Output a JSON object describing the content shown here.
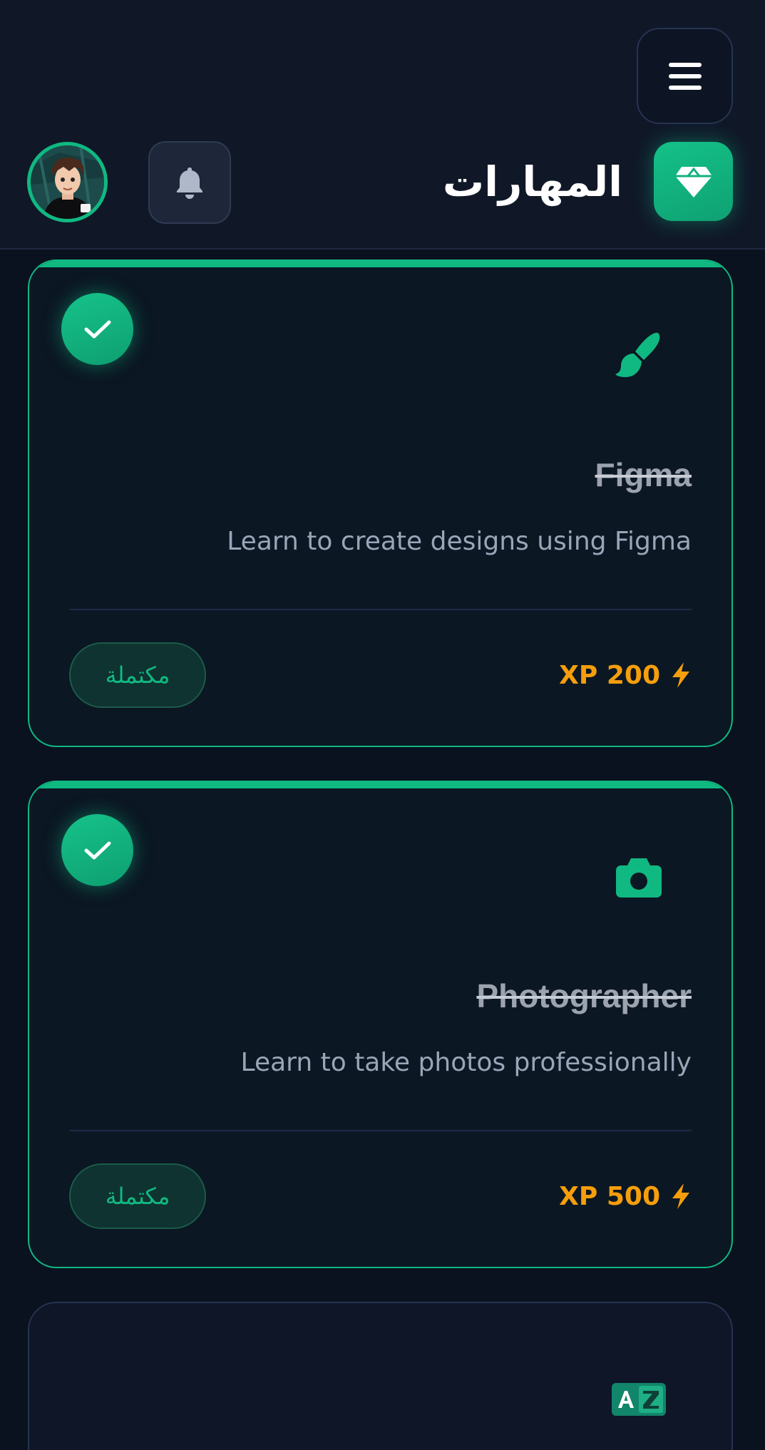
{
  "header": {
    "title": "المهارات",
    "menu_icon": "hamburger-menu-icon",
    "brand_icon": "diamond-icon",
    "notification_icon": "bell-icon",
    "avatar_alt": "user-avatar"
  },
  "colors": {
    "accent": "#10b981",
    "xp": "#f59e0b",
    "background": "#0a1220",
    "header": "#101828"
  },
  "skills": [
    {
      "icon": "paintbrush-icon",
      "title": "Figma",
      "description": "Learn to create designs using Figma",
      "status": "مكتملة",
      "xp": "XP 200",
      "completed": true
    },
    {
      "icon": "camera-icon",
      "title": "Photographer",
      "description": "Learn to take photos professionally",
      "status": "مكتملة",
      "xp": "XP 500",
      "completed": true
    },
    {
      "icon": "translate-icon",
      "completed": false
    }
  ]
}
